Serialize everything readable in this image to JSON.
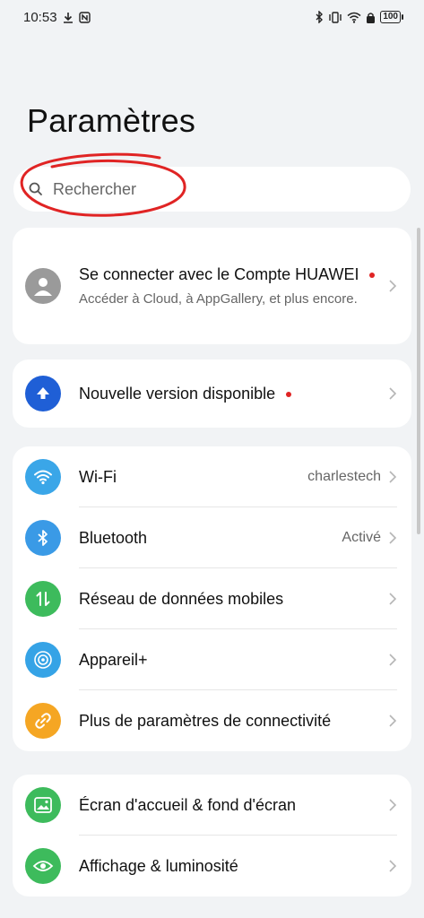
{
  "status_bar": {
    "time": "10:53",
    "battery": "100"
  },
  "header": {
    "title": "Paramètres"
  },
  "search": {
    "placeholder": "Rechercher"
  },
  "account": {
    "title": "Se connecter avec le Compte HUAWEI",
    "subtitle": "Accéder à Cloud, à AppGallery, et plus encore."
  },
  "update": {
    "label": "Nouvelle version disponible"
  },
  "connectivity": {
    "items": [
      {
        "label": "Wi-Fi",
        "value": "charlestech",
        "icon": "wifi-icon",
        "color": "#3aa6e8"
      },
      {
        "label": "Bluetooth",
        "value": "Activé",
        "icon": "bluetooth-icon",
        "color": "#3a9ae6"
      },
      {
        "label": "Réseau de données mobiles",
        "value": "",
        "icon": "mobile-data-icon",
        "color": "#3dbb5c"
      },
      {
        "label": "Appareil+",
        "value": "",
        "icon": "device-plus-icon",
        "color": "#35a3e6"
      },
      {
        "label": "Plus de paramètres de connectivité",
        "value": "",
        "icon": "link-icon",
        "color": "#f5a623"
      }
    ]
  },
  "display": {
    "items": [
      {
        "label": "Écran d'accueil & fond d'écran",
        "icon": "wallpaper-icon",
        "color": "#3dbb5c"
      },
      {
        "label": "Affichage & luminosité",
        "icon": "eye-icon",
        "color": "#3dbb5c"
      }
    ]
  }
}
